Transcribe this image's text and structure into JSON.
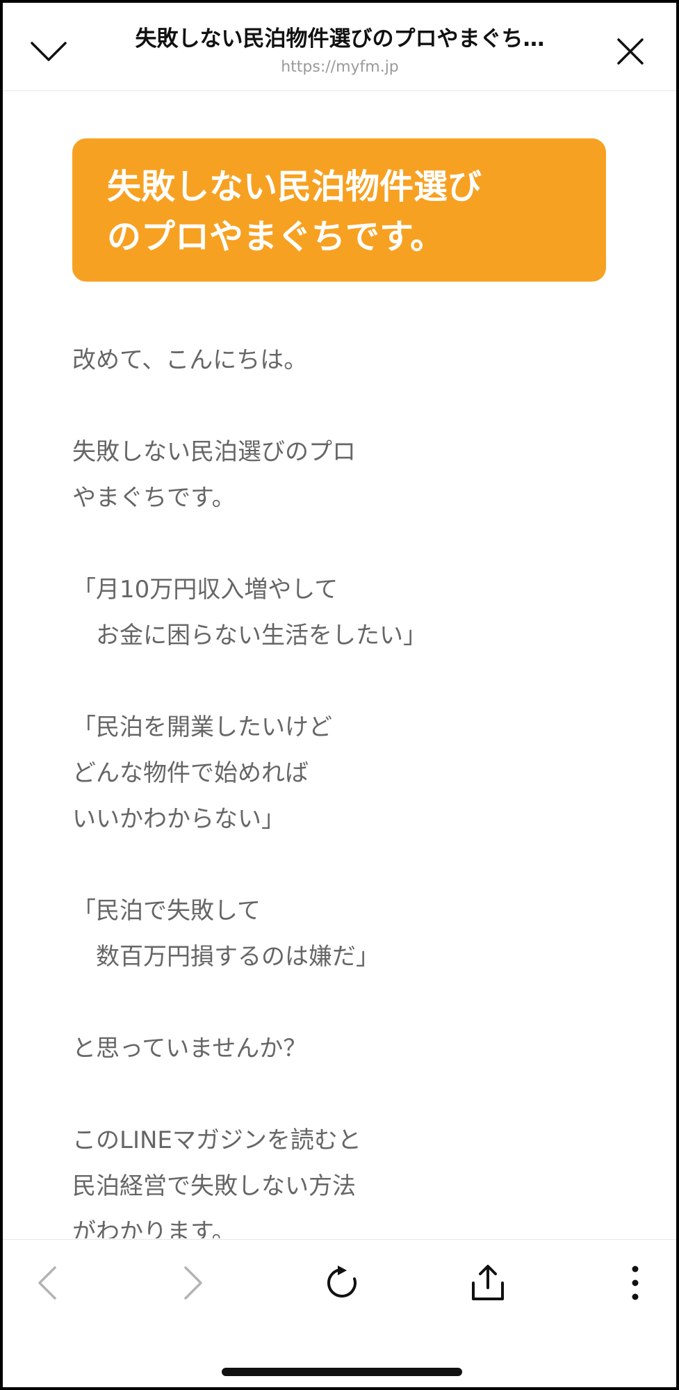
{
  "header": {
    "title": "失敗しない民泊物件選びのプロやまぐち…",
    "url": "https://myfm.jp",
    "left_icon": "chevron-down-icon",
    "right_icon": "close-icon"
  },
  "banner": {
    "line1": "失敗しない民泊物件選び",
    "line2": "のプロやまぐちです。",
    "color": "#f7a122"
  },
  "body": {
    "p1": [
      "改めて、こんにちは。"
    ],
    "p2": [
      "失敗しない民泊選びのプロ",
      "やまぐちです。"
    ],
    "p3": [
      "「月10万円収入増やして",
      "　お金に困らない生活をしたい」"
    ],
    "p4": [
      "「民泊を開業したいけど",
      "どんな物件で始めれば",
      "いいかわからない」"
    ],
    "p5": [
      "「民泊で失敗して",
      "　数百万円損するのは嫌だ」"
    ],
    "p6": [
      "と思っていませんか？"
    ],
    "p7": [
      "このLINEマガジンを読むと",
      "民泊経営で失敗しない方法",
      "がわかります。"
    ]
  },
  "toolbar": {
    "back_icon": "chevron-left-icon",
    "forward_icon": "chevron-right-icon",
    "reload_icon": "reload-icon",
    "share_icon": "share-icon",
    "more_icon": "more-vertical-icon"
  }
}
